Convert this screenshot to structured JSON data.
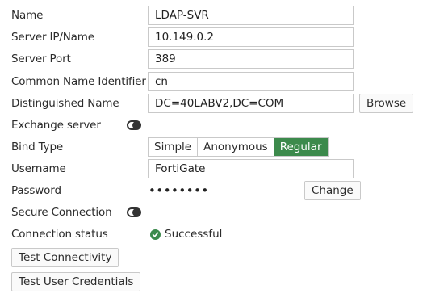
{
  "form": {
    "name": {
      "label": "Name",
      "value": "LDAP-SVR"
    },
    "server_ip": {
      "label": "Server IP/Name",
      "value": "10.149.0.2"
    },
    "server_port": {
      "label": "Server Port",
      "value": "389"
    },
    "cn_identifier": {
      "label": "Common Name Identifier",
      "value": "cn"
    },
    "distinguished_name": {
      "label": "Distinguished Name",
      "value": "DC=40LABV2,DC=COM",
      "browse_label": "Browse"
    },
    "exchange_server": {
      "label": "Exchange server",
      "enabled": false
    },
    "bind_type": {
      "label": "Bind Type",
      "options": [
        "Simple",
        "Anonymous",
        "Regular"
      ],
      "selected": "Regular"
    },
    "username": {
      "label": "Username",
      "value": "FortiGate"
    },
    "password": {
      "label": "Password",
      "masked_value": "••••••••",
      "change_label": "Change"
    },
    "secure_connection": {
      "label": "Secure Connection",
      "enabled": false
    },
    "connection_status": {
      "label": "Connection status",
      "value": "Successful",
      "icon": "check-circle-icon",
      "color": "#3c8a4c"
    }
  },
  "actions": {
    "test_connectivity": "Test Connectivity",
    "test_user_credentials": "Test User Credentials"
  },
  "colors": {
    "accent": "#3c8a4c",
    "border": "#c9c9c9",
    "text": "#2b2b2b"
  }
}
